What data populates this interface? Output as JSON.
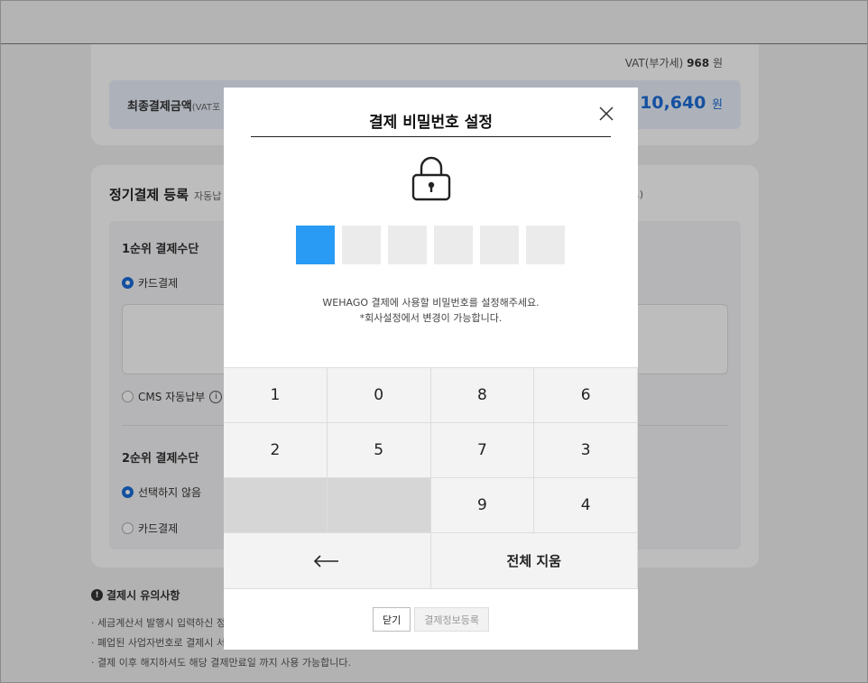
{
  "background": {
    "vat_label": "VAT(부가세)",
    "vat_amount": "968",
    "vat_unit": "원",
    "final_label": "최종결제금액",
    "final_label_note": "(VAT포",
    "final_amount": "10,640",
    "final_unit": "원",
    "register_title": "정기결제 등록",
    "register_sub": "자동납",
    "register_right": ".)",
    "primary_method_title": "1순위 결제수단",
    "primary_card_option": "카드결제",
    "primary_cms_option": "CMS 자동납부",
    "secondary_method_title": "2순위 결제수단",
    "secondary_none_option": "선택하지 않음",
    "secondary_card_option": "카드결제",
    "notice_title": "결제시 유의사항",
    "notices": [
      "· 세금계산서 발행시 입력하신 정",
      "· 폐업된 사업자번호로 결제시 서",
      "· 결제 이후 해지하셔도 해당 결제만료일 까지 사용 가능합니다."
    ]
  },
  "modal": {
    "title": "결제 비밀번호 설정",
    "message_line1": "WEHAGO 결제에 사용할 비밀번호를 설정해주세요.",
    "message_line2": "*회사설정에서 변경이 가능합니다.",
    "pin_length": 6,
    "pin_filled": 0,
    "keypad": {
      "row1": [
        "1",
        "0",
        "8",
        "6"
      ],
      "row2": [
        "2",
        "5",
        "7",
        "3"
      ],
      "row3": [
        "",
        "",
        "9",
        "4"
      ],
      "backspace_symbol": "←",
      "clear_label": "전체 지움"
    },
    "close_label": "닫기",
    "register_label": "결제정보등록"
  },
  "colors": {
    "accent": "#1c6dd8",
    "pin_active": "#2a9bf5"
  }
}
